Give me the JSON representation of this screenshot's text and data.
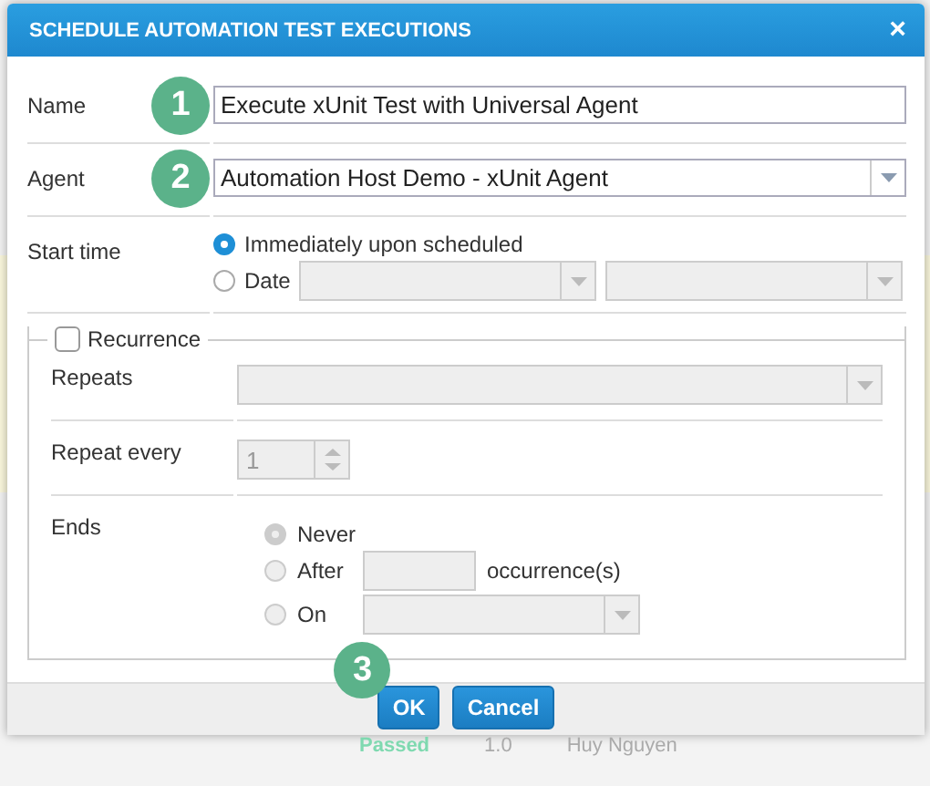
{
  "dialog": {
    "title": "SCHEDULE AUTOMATION TEST EXECUTIONS",
    "close": "×"
  },
  "fields": [
    {
      "label": "Name",
      "step": "1",
      "kind": "text",
      "value": "Execute xUnit Test with Universal Agent"
    },
    {
      "label": "Agent",
      "step": "2",
      "kind": "select",
      "value": "Automation Host Demo - xUnit Agent"
    }
  ],
  "start_time": {
    "label": "Start time",
    "options": [
      {
        "label": "Immediately upon scheduled",
        "selected": true,
        "kind": "plain"
      },
      {
        "label": "Date",
        "selected": false,
        "kind": "date"
      }
    ]
  },
  "recurrence": {
    "label": "Recurrence",
    "checked": false,
    "repeats_label": "Repeats",
    "repeat_every_label": "Repeat every",
    "repeat_every_value": "1",
    "ends_label": "Ends",
    "ends_options": [
      {
        "label": "Never",
        "selected": true,
        "kind": "plain"
      },
      {
        "label": "After",
        "selected": false,
        "kind": "count",
        "suffix": "occurrence(s)"
      },
      {
        "label": "On",
        "selected": false,
        "kind": "date"
      }
    ]
  },
  "buttons": [
    {
      "label": "OK",
      "step": "3"
    },
    {
      "label": "Cancel"
    }
  ],
  "background_row": {
    "status": "Passed",
    "version": "1.0",
    "owner": "Huy Nguyen"
  }
}
